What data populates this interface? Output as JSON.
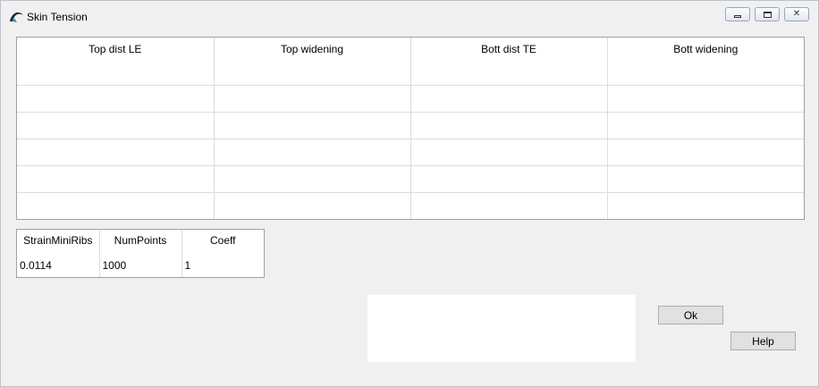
{
  "window": {
    "title": "Skin Tension",
    "app_icon": "glider-icon",
    "controls": {
      "minimize": "minimize-icon",
      "maximize": "maximize-icon",
      "close": "✕"
    }
  },
  "top_grid": {
    "columns": [
      "Top dist LE",
      "Top widening",
      "Bott dist TE",
      "Bott widening"
    ],
    "rows": [
      [
        "",
        "",
        "",
        ""
      ],
      [
        "",
        "",
        "",
        ""
      ],
      [
        "",
        "",
        "",
        ""
      ],
      [
        "",
        "",
        "",
        ""
      ],
      [
        "",
        "",
        "",
        ""
      ]
    ]
  },
  "bottom_grid": {
    "columns": [
      "StrainMiniRibs",
      "NumPoints",
      "Coeff"
    ],
    "rows": [
      [
        "0.0114",
        "1000",
        "1"
      ]
    ]
  },
  "buttons": {
    "ok": "Ok",
    "help": "Help"
  }
}
